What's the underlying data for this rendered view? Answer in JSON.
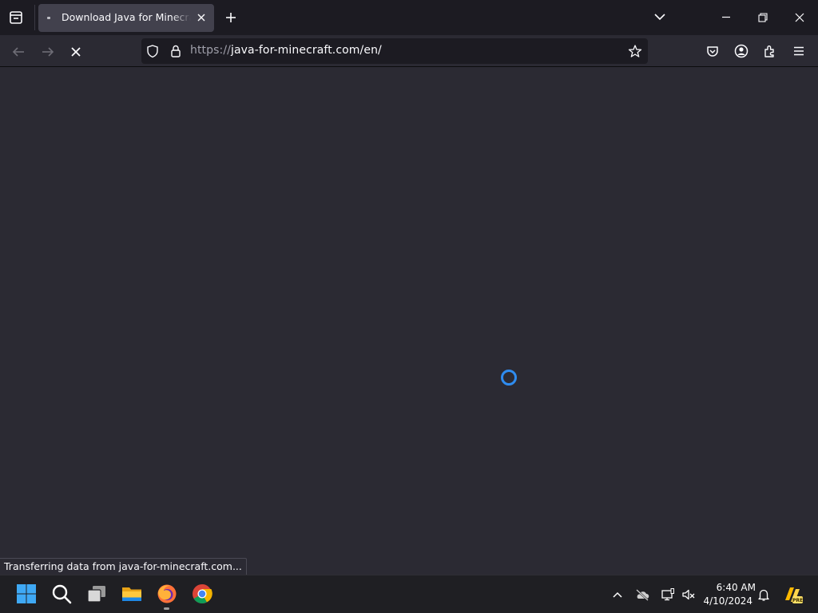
{
  "browser": {
    "tab": {
      "title": "Download Java for Minecraft (R"
    },
    "url": {
      "scheme": "https://",
      "rest": "java-for-minecraft.com/en/"
    },
    "status_text": "Transferring data from java-for-minecraft.com..."
  },
  "taskbar": {
    "clock_time": "6:40 AM",
    "clock_date": "4/10/2024",
    "apps": [
      "start-icon",
      "search-icon",
      "task-view-icon",
      "file-explorer-icon",
      "firefox-icon",
      "chrome-icon"
    ]
  },
  "colors": {
    "accent": "#2f8cf0",
    "background": "#2b2a33",
    "tabstrip": "#1c1b22"
  }
}
